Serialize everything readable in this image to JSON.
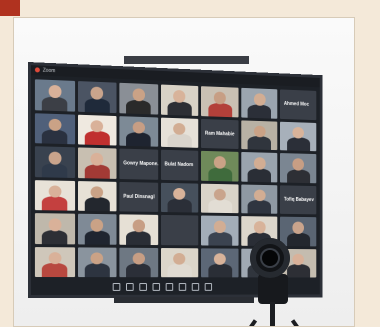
{
  "screen": {
    "title": "Zoom"
  },
  "tiles": [
    {
      "type": "person",
      "name": "Participant",
      "skin": "#d9b199",
      "shirt": "#3c3f46",
      "bg": "#6a7a8c"
    },
    {
      "type": "person",
      "name": "Participant",
      "skin": "#c9a48c",
      "shirt": "#1f2a3a",
      "bg": "#4b5463"
    },
    {
      "type": "person",
      "name": "Participant",
      "skin": "#caa286",
      "shirt": "#2a2a2a",
      "bg": "#8a8f96"
    },
    {
      "type": "person",
      "name": "Participant",
      "skin": "#d8b39a",
      "shirt": "#2d2f35",
      "bg": "#d8d2c6"
    },
    {
      "type": "person",
      "name": "Participant",
      "skin": "#c79e84",
      "shirt": "#b3403a",
      "bg": "#c9c0b3"
    },
    {
      "type": "person",
      "name": "Participant",
      "skin": "#d2ad93",
      "shirt": "#2b2f38",
      "bg": "#9ba5af"
    },
    {
      "type": "label",
      "text": "Ahmed Moc"
    },
    {
      "type": "person",
      "name": "Participant",
      "skin": "#caa286",
      "shirt": "#2a3140",
      "bg": "#50607a"
    },
    {
      "type": "person",
      "name": "Participant",
      "skin": "#d9b199",
      "shirt": "#c0302f",
      "bg": "#efe9e0"
    },
    {
      "type": "person",
      "name": "Participant",
      "skin": "#c79e84",
      "shirt": "#1e2430",
      "bg": "#7d8a96"
    },
    {
      "type": "person",
      "name": "Participant",
      "skin": "#d2ad93",
      "shirt": "#d9d4cc",
      "bg": "#e6e1d8"
    },
    {
      "type": "label",
      "text": "Ram Mahabie"
    },
    {
      "type": "person",
      "name": "Participant",
      "skin": "#caa286",
      "shirt": "#30353d",
      "bg": "#b8b1a4"
    },
    {
      "type": "person",
      "name": "Participant",
      "skin": "#d8b39a",
      "shirt": "#2b2f38",
      "bg": "#a7b0ba"
    },
    {
      "type": "person",
      "name": "Participant",
      "skin": "#c9a48c",
      "shirt": "#2f3a4a",
      "bg": "#39424f"
    },
    {
      "type": "person",
      "name": "Participant",
      "skin": "#d9b199",
      "shirt": "#a23a35",
      "bg": "#c8bfb1"
    },
    {
      "type": "label",
      "text": "Gowry Mapone..."
    },
    {
      "type": "label",
      "text": "Bulat Nadom"
    },
    {
      "type": "person",
      "name": "Participant",
      "skin": "#caa286",
      "shirt": "#3f6b3c",
      "bg": "#6f8a5a"
    },
    {
      "type": "person",
      "name": "Participant",
      "skin": "#d2ad93",
      "shirt": "#2a2e36",
      "bg": "#9aa4ae"
    },
    {
      "type": "person",
      "name": "Participant",
      "skin": "#c79e84",
      "shirt": "#2d2f35",
      "bg": "#7b8692"
    },
    {
      "type": "person",
      "name": "Participant",
      "skin": "#d9b199",
      "shirt": "#c4403f",
      "bg": "#e8e2d8"
    },
    {
      "type": "person",
      "name": "Participant",
      "skin": "#caa286",
      "shirt": "#23272e",
      "bg": "#e7e1d6"
    },
    {
      "type": "label",
      "text": "Paul Dinsnagl"
    },
    {
      "type": "person",
      "name": "Participant",
      "skin": "#d8b39a",
      "shirt": "#2b2f38",
      "bg": "#46505c"
    },
    {
      "type": "person",
      "name": "Participant",
      "skin": "#c9a48c",
      "shirt": "#e2ddd4",
      "bg": "#d9d3c8"
    },
    {
      "type": "person",
      "name": "Participant",
      "skin": "#d2ad93",
      "shirt": "#2f3540",
      "bg": "#8f99a3"
    },
    {
      "type": "label",
      "text": "Tofiq Babayev"
    },
    {
      "type": "person",
      "name": "Participant",
      "skin": "#d9b199",
      "shirt": "#2d2f35",
      "bg": "#bfb8ab"
    },
    {
      "type": "person",
      "name": "Participant",
      "skin": "#caa286",
      "shirt": "#1f2530",
      "bg": "#7f8a96"
    },
    {
      "type": "person",
      "name": "Participant",
      "skin": "#c79e84",
      "shirt": "#2a2e36",
      "bg": "#e6e0d5"
    },
    {
      "type": "label",
      "text": ""
    },
    {
      "type": "person",
      "name": "Participant",
      "skin": "#d2ad93",
      "shirt": "#3b4350",
      "bg": "#a3adb8"
    },
    {
      "type": "person",
      "name": "Participant",
      "skin": "#d8b39a",
      "shirt": "#2a2e36",
      "bg": "#dcd6cb"
    },
    {
      "type": "person",
      "name": "Participant",
      "skin": "#c9a48c",
      "shirt": "#23272e",
      "bg": "#5a6573"
    },
    {
      "type": "person",
      "name": "Participant",
      "skin": "#d9b199",
      "shirt": "#b8483f",
      "bg": "#cfc7ba"
    },
    {
      "type": "person",
      "name": "Participant",
      "skin": "#caa286",
      "shirt": "#2d3440",
      "bg": "#8a949e"
    },
    {
      "type": "person",
      "name": "Participant",
      "skin": "#c79e84",
      "shirt": "#2b2f38",
      "bg": "#6e7883"
    },
    {
      "type": "person",
      "name": "Participant",
      "skin": "#d2ad93",
      "shirt": "#e0dbd2",
      "bg": "#dcd6ca"
    },
    {
      "type": "person",
      "name": "Participant",
      "skin": "#d8b39a",
      "shirt": "#2a2e36",
      "bg": "#5c6776"
    },
    {
      "type": "person",
      "name": "Participant",
      "skin": "#c9a48c",
      "shirt": "#30353d",
      "bg": "#a0a9b3"
    },
    {
      "type": "person",
      "name": "Participant",
      "skin": "#d9b199",
      "shirt": "#2d2f35",
      "bg": "#c4bcaf"
    }
  ],
  "toolbar": {
    "icons": [
      "mute-icon",
      "video-icon",
      "security-icon",
      "participants-icon",
      "chat-icon",
      "share-icon",
      "record-icon",
      "reactions-icon"
    ]
  },
  "colors": {
    "accent": "#b0321f",
    "page_bg": "#f4e9d9",
    "screen_bg": "#1d2127"
  }
}
